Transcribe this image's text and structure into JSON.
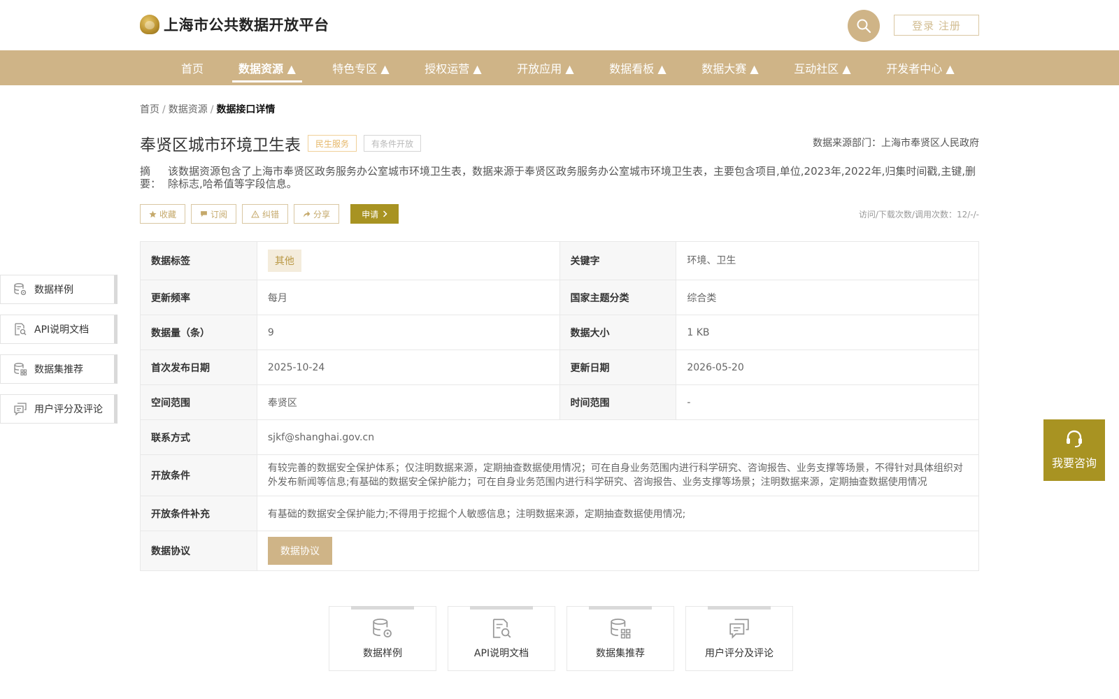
{
  "header": {
    "site_title": "上海市公共数据开放平台",
    "login_label": "登录 注册"
  },
  "nav": {
    "items": [
      {
        "label": "首页"
      },
      {
        "label": "数据资源 ▲"
      },
      {
        "label": "特色专区 ▲"
      },
      {
        "label": "授权运营 ▲"
      },
      {
        "label": "开放应用 ▲"
      },
      {
        "label": "数据看板 ▲"
      },
      {
        "label": "数据大赛 ▲"
      },
      {
        "label": "互动社区 ▲"
      },
      {
        "label": "开发者中心 ▲"
      }
    ],
    "active_index": 1
  },
  "breadcrumb": {
    "items": [
      "首页",
      "数据资源",
      "数据接口详情"
    ],
    "separator": "/"
  },
  "dataset": {
    "title": "奉贤区城市环境卫生表",
    "tags": [
      "民生服务",
      "有条件开放"
    ],
    "source_label": "数据来源部门：上海市奉贤区人民政府",
    "abstract_label": "摘要：",
    "abstract_text": "该数据资源包含了上海市奉贤区政务服务办公室城市环境卫生表，数据来源于奉贤区政务服务办公室城市环境卫生表，主要包含项目,单位,2023年,2022年,归集时间戳,主键,删除标志,哈希值等字段信息。",
    "stats": "访问/下载次数/调用次数：12/-/-"
  },
  "actions": {
    "favorite": "收藏",
    "subscribe": "订阅",
    "report": "纠错",
    "share": "分享",
    "apply": "申请"
  },
  "meta": {
    "tag_label": "数据标签",
    "tag_value": "其他",
    "keyword_label": "关键字",
    "keyword_value": "环境、卫生",
    "freq_label": "更新频率",
    "freq_value": "每月",
    "theme_label": "国家主题分类",
    "theme_value": "综合类",
    "count_label": "数据量（条）",
    "count_value": "9",
    "size_label": "数据大小",
    "size_value": "1 KB",
    "first_label": "首次发布日期",
    "first_value": "2025-10-24",
    "update_label": "更新日期",
    "update_value": "2026-05-20",
    "space_label": "空间范围",
    "space_value": "奉贤区",
    "time_label": "时间范围",
    "time_value": "-",
    "contact_label": "联系方式",
    "contact_value": "sjkf@shanghai.gov.cn",
    "cond_label": "开放条件",
    "cond_value": "有较完善的数据安全保护体系；仅注明数据来源，定期抽查数据使用情况；可在自身业务范围内进行科学研究、咨询报告、业务支撑等场景，不得针对具体组织对外发布新闻等信息;有基础的数据安全保护能力；可在自身业务范围内进行科学研究、咨询报告、业务支撑等场景；注明数据来源，定期抽查数据使用情况",
    "cond_extra_label": "开放条件补充",
    "cond_extra_value": "有基础的数据安全保护能力;不得用于挖掘个人敏感信息；注明数据来源，定期抽查数据使用情况;",
    "agreement_label": "数据协议",
    "agreement_button": "数据协议"
  },
  "side_nav": {
    "items": [
      {
        "label": "数据样例",
        "icon": "database-gear-icon"
      },
      {
        "label": "API说明文档",
        "icon": "doc-search-icon"
      },
      {
        "label": "数据集推荐",
        "icon": "database-grid-icon"
      },
      {
        "label": "用户评分及评论",
        "icon": "comment-icon"
      }
    ]
  },
  "consult": {
    "label": "我要咨询",
    "icon": "headset-icon"
  },
  "bottom_cards": {
    "items": [
      {
        "label": "数据样例"
      },
      {
        "label": "API说明文档"
      },
      {
        "label": "数据集推荐"
      },
      {
        "label": "用户评分及评论"
      }
    ]
  },
  "colors": {
    "brand": "#cfb487",
    "accent": "#a89322",
    "tag_service": "#e6b86a"
  }
}
